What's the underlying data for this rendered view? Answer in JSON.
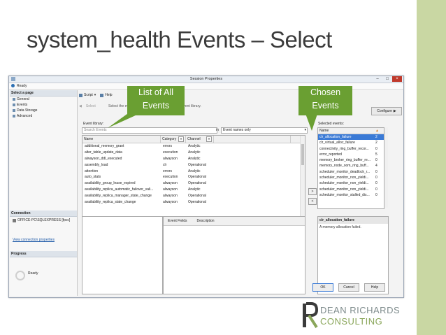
{
  "slide": {
    "title": "system_health Events – Select"
  },
  "window": {
    "title": "Session Properties",
    "status": "Ready",
    "select_page_header": "Select a page",
    "pages": [
      "General",
      "Events",
      "Data Storage",
      "Advanced"
    ],
    "connection_header": "Connection",
    "server": "OFFICE-PC\\SQLEXPRESS [fpcc]",
    "view_connection_link": "View connection properties",
    "progress_header": "Progress",
    "progress_status": "Ready",
    "toolbar": {
      "script": "Script",
      "help": "Help"
    },
    "select_label": "Select",
    "description": "Select the events you want to capture from the event library.",
    "configure_button": "Configure",
    "event_library_label": "Event library:",
    "search_placeholder": "Search Events",
    "search_in_label": "in",
    "search_in_value": "Event names only",
    "library_columns": [
      "Name",
      "Category",
      "Channel"
    ],
    "library_rows": [
      [
        "additional_memory_grant",
        "errors",
        "Analytic"
      ],
      [
        "alter_table_update_data",
        "execution",
        "Analytic"
      ],
      [
        "alwayson_ddl_executed",
        "alwayson",
        "Analytic"
      ],
      [
        "assembly_load",
        "clr",
        "Operational"
      ],
      [
        "attention",
        "errors",
        "Analytic"
      ],
      [
        "auto_stats",
        "execution",
        "Operational"
      ],
      [
        "availability_group_lease_expired",
        "alwayson",
        "Operational"
      ],
      [
        "availability_replica_automatic_failover_vali...",
        "alwayson",
        "Analytic"
      ],
      [
        "availability_replica_manager_state_change",
        "alwayson",
        "Operational"
      ],
      [
        "availability_replica_state_change",
        "alwayson",
        "Operational"
      ]
    ],
    "selected_label": "Selected events:",
    "selected_columns": [
      "Name"
    ],
    "selected_rows": [
      [
        "clr_allocation_failure",
        "2"
      ],
      [
        "clr_virtual_alloc_failure",
        "2"
      ],
      [
        "connectivity_ring_buffer_recor...",
        "0"
      ],
      [
        "error_reported",
        "5"
      ],
      [
        "memory_broker_ring_buffer_re...",
        "0"
      ],
      [
        "memory_node_oom_ring_buff...",
        "4"
      ],
      [
        "scheduler_monitor_deadlock_r...",
        "0"
      ],
      [
        "scheduler_monitor_non_yieldi...",
        "0"
      ],
      [
        "scheduler_monitor_non_yieldi...",
        "0"
      ],
      [
        "scheduler_monitor_non_yieldi...",
        "0"
      ],
      [
        "scheduler_monitor_stalled_dis...",
        "0"
      ]
    ],
    "field_columns": [
      "Event Fields",
      "Description"
    ],
    "detail_name": "clr_allocation_failure",
    "detail_description": "A memory allocation failed.",
    "buttons": {
      "ok": "OK",
      "cancel": "Cancel",
      "help": "Help"
    }
  },
  "callouts": {
    "left_line1": "List of All",
    "left_line2": "Events",
    "right_line1": "Chosen",
    "right_line2": "Events"
  },
  "logo": {
    "line1": "DEAN RICHARDS",
    "line2": "CONSULTING"
  },
  "colors": {
    "callout": "#6a9f32",
    "band": "#c9d7a3",
    "selection": "#3a7ad6"
  }
}
